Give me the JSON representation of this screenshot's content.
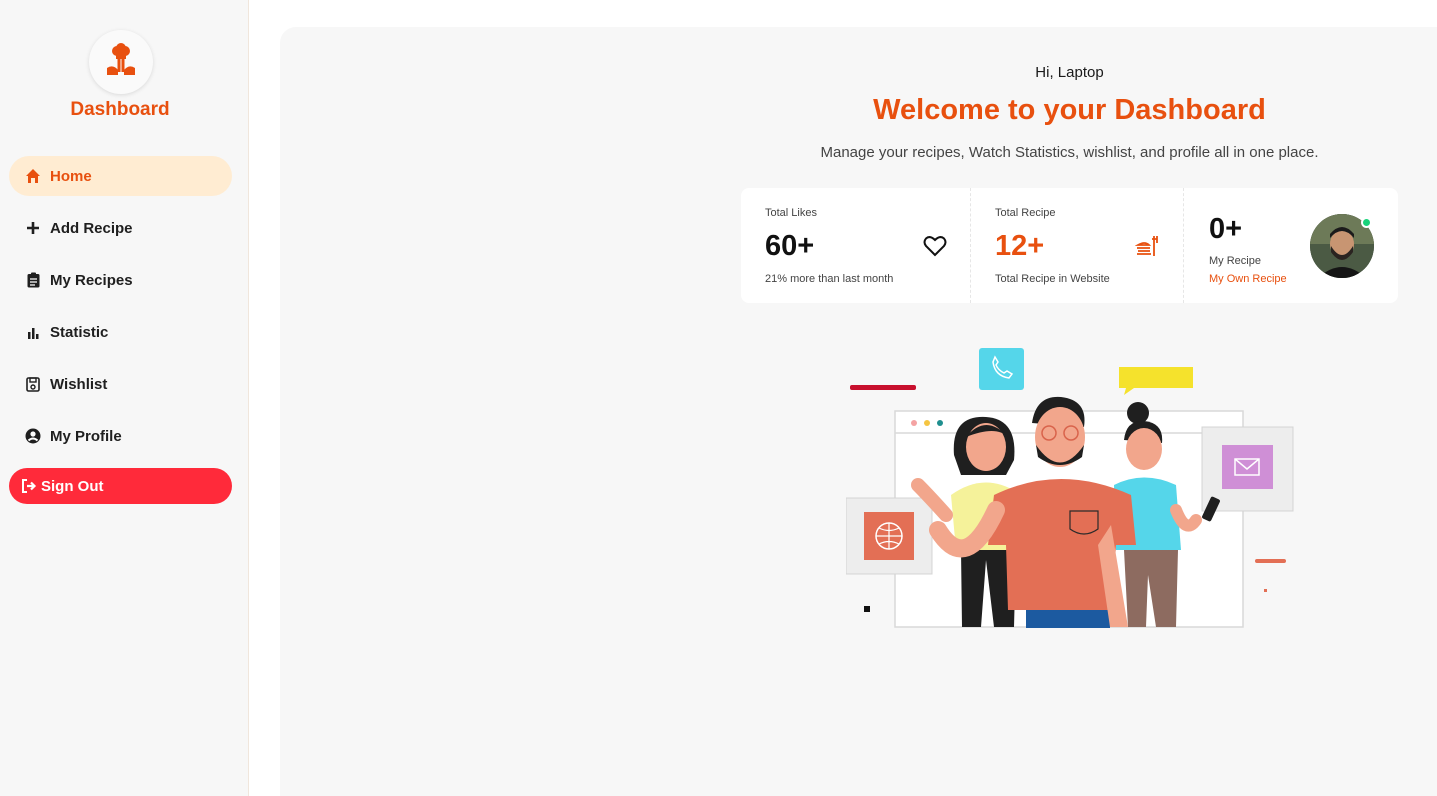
{
  "brand": {
    "title": "Dashboard",
    "logo_icon": "chef-hat-icon",
    "accent": "#e8500f"
  },
  "sidebar": {
    "items": [
      {
        "label": "Home",
        "icon": "home-icon",
        "active": true
      },
      {
        "label": "Add Recipe",
        "icon": "plus-icon"
      },
      {
        "label": "My Recipes",
        "icon": "clipboard-icon"
      },
      {
        "label": "Statistic",
        "icon": "bar-chart-icon"
      },
      {
        "label": "Wishlist",
        "icon": "save-icon"
      },
      {
        "label": "My Profile",
        "icon": "user-circle-icon"
      }
    ],
    "signout": {
      "label": "Sign Out",
      "icon": "sign-out-icon",
      "color": "#ff2a3a"
    }
  },
  "header": {
    "greeting": "Hi, Laptop",
    "title": "Welcome to your Dashboard",
    "subtitle": "Manage your recipes, Watch Statistics, wishlist, and profile all in one place."
  },
  "stats": [
    {
      "label": "Total Likes",
      "value": "60+",
      "desc": "21% more than last month",
      "icon": "heart-icon"
    },
    {
      "label": "Total Recipe",
      "value": "12+",
      "desc": "Total Recipe in Website",
      "icon": "food-tray-icon"
    },
    {
      "label": "My Recipe",
      "value": "0+",
      "desc": "My Own Recipe",
      "icon": "avatar"
    }
  ]
}
